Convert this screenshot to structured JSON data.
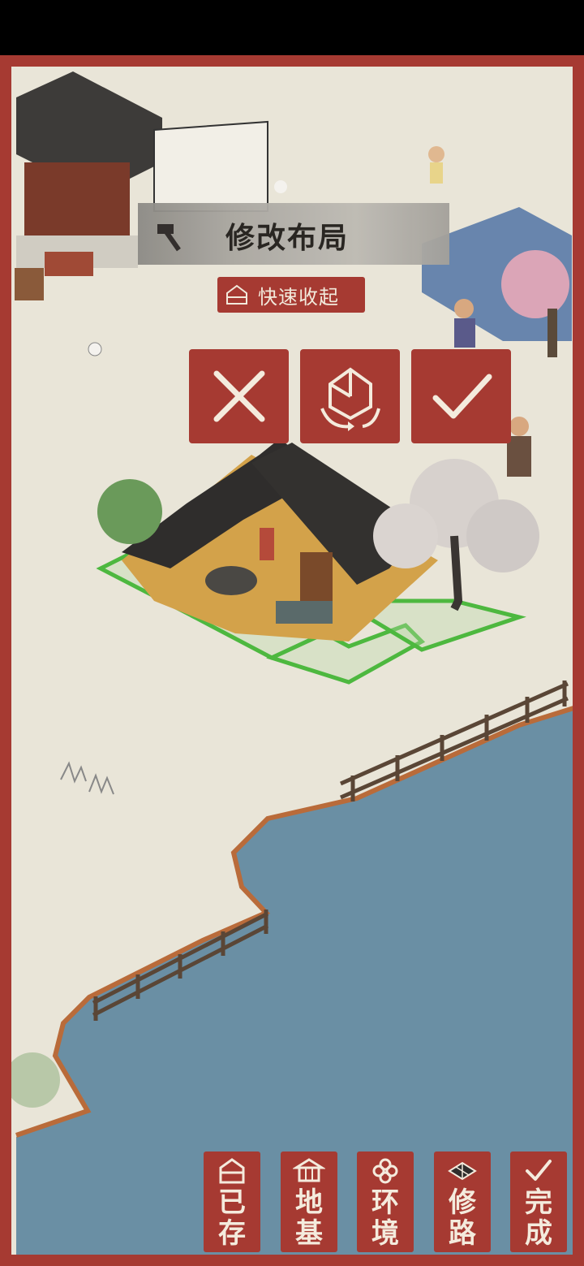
{
  "top_banner": {
    "title": "修改布局",
    "icon": "hammer-icon"
  },
  "quick_store": {
    "label": "快速收起",
    "icon": "house-box-icon"
  },
  "action_buttons": [
    {
      "name": "cancel",
      "icon": "cross-icon"
    },
    {
      "name": "rotate",
      "icon": "rotate-house-icon"
    },
    {
      "name": "confirm",
      "icon": "check-icon"
    }
  ],
  "bottom_menu": [
    {
      "chars": [
        "已",
        "存"
      ],
      "icon": "stored-box-icon"
    },
    {
      "chars": [
        "地",
        "基"
      ],
      "icon": "foundation-icon"
    },
    {
      "chars": [
        "环",
        "境"
      ],
      "icon": "flower-icon"
    },
    {
      "chars": [
        "修",
        "路"
      ],
      "icon": "road-tile-icon"
    },
    {
      "chars": [
        "完",
        "成"
      ],
      "icon": "check-icon"
    }
  ],
  "colors": {
    "frame_red": "#a63a32",
    "paper": "#e9e5d8",
    "water": "#6a8fa4",
    "grid_green": "#4db83f"
  }
}
